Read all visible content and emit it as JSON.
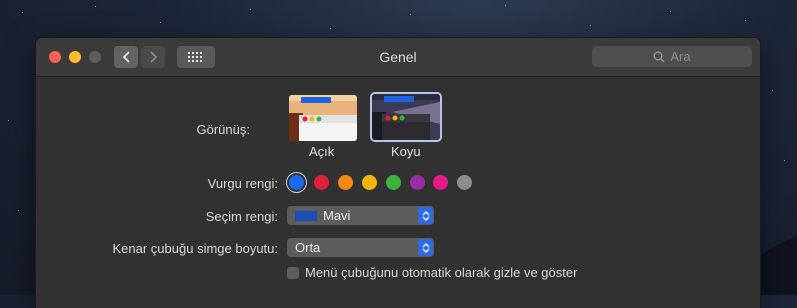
{
  "window": {
    "title": "Genel"
  },
  "search": {
    "placeholder": "Ara"
  },
  "appearance": {
    "label": "Görünüş:",
    "options": [
      {
        "label": "Açık"
      },
      {
        "label": "Koyu"
      }
    ],
    "selected": "Koyu"
  },
  "accent": {
    "label": "Vurgu rengi:",
    "colors": [
      "#1d6cf0",
      "#e0203b",
      "#f28a13",
      "#f5b50f",
      "#3cb43c",
      "#9a2ca6",
      "#e61a8c",
      "#8c8c8c"
    ],
    "selected_index": 0
  },
  "highlight": {
    "label": "Seçim rengi:",
    "value": "Mavi",
    "swatch": "#1b4fb5"
  },
  "sidebar_icon_size": {
    "label": "Kenar çubuğu simge boyutu:",
    "value": "Orta"
  },
  "menubar_autohide": {
    "label": "Menü çubuğunu otomatik olarak gizle ve göster",
    "checked": false
  }
}
